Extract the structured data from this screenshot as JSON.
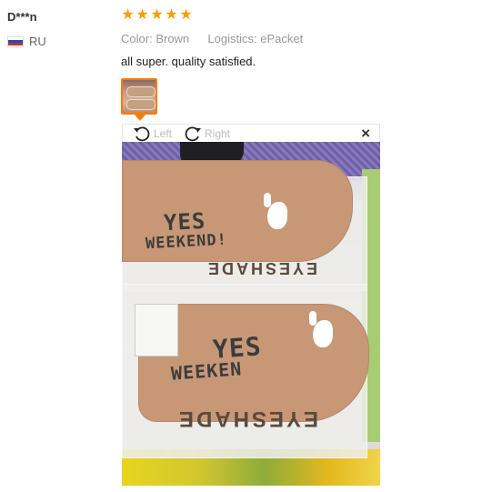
{
  "reviewer": {
    "name": "D***n",
    "country_code": "RU",
    "flag_colors": [
      "#ffffff",
      "#1f4fb3",
      "#d52b1e"
    ]
  },
  "review": {
    "rating": 5,
    "stars": [
      "★",
      "★",
      "★",
      "★",
      "★"
    ],
    "star_color": "#ff9a00",
    "color_label": "Color:",
    "color_value": "Brown",
    "logistics_label": "Logistics:",
    "logistics_value": "ePacket",
    "text": "all super. quality satisfied."
  },
  "viewer": {
    "rotate_left_label": "Left",
    "rotate_right_label": "Right",
    "close_glyph": "×",
    "rotate_left_icon": "rotate-left-icon",
    "rotate_right_icon": "rotate-right-icon",
    "photo_texts": {
      "yes": "YES",
      "weekend": "WEEKEND!",
      "weeken": "WEEKEN",
      "eyeshade": "EYESHADE"
    }
  },
  "accent_color": "#ff7a00"
}
